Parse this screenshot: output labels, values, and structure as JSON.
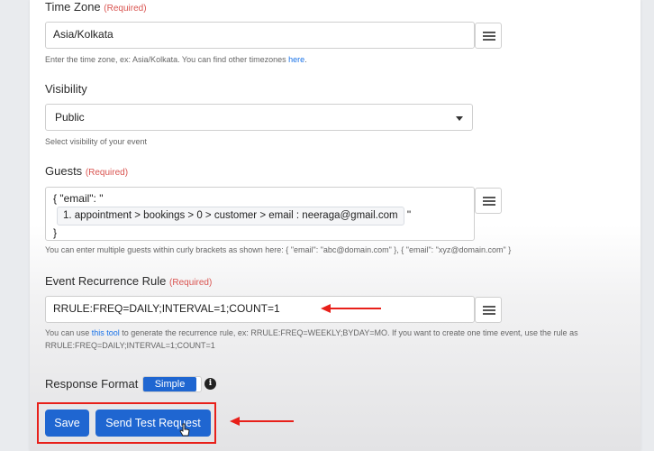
{
  "timezone": {
    "label": "Time Zone",
    "required": "(Required)",
    "value": "Asia/Kolkata",
    "help_prefix": "Enter the time zone, ex: Asia/Kolkata. You can find other timezones ",
    "help_link": "here",
    "help_suffix": "."
  },
  "visibility": {
    "label": "Visibility",
    "value": "Public",
    "help": "Select visibility of your event"
  },
  "guests": {
    "label": "Guests",
    "required": "(Required)",
    "line1": "{ \"email\": \"",
    "tag": "1. appointment > bookings > 0 > customer > email : neeraga@gmail.com",
    "tag_suffix": "\"",
    "line3": "}",
    "help": "You can enter multiple guests within curly brackets as shown here: { \"email\": \"abc@domain.com\" }, { \"email\": \"xyz@domain.com\" }"
  },
  "recurrence": {
    "label": "Event Recurrence Rule",
    "required": "(Required)",
    "value": "RRULE:FREQ=DAILY;INTERVAL=1;COUNT=1",
    "help_prefix": "You can use ",
    "help_link": "this tool",
    "help_suffix": " to generate the recurrence rule, ex: RRULE:FREQ=WEEKLY;BYDAY=MO. If you want to create one time event, use the rule as RRULE:FREQ=DAILY;INTERVAL=1;COUNT=1"
  },
  "response_format": {
    "label": "Response Format",
    "toggle_value": "Simple"
  },
  "actions": {
    "save_label": "Save",
    "test_label": "Send Test Request"
  },
  "colors": {
    "primary": "#1f66d1",
    "required": "#d9534f",
    "annotation": "#e8201a"
  }
}
